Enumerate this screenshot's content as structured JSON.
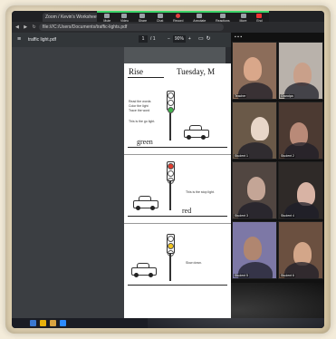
{
  "browser": {
    "tab_title": "Zoom / Kevin's Worksheet",
    "url": "file:///C:/Users/Documents/traffic-lights.pdf"
  },
  "zoom_toolbar": {
    "buttons": [
      {
        "label": "Mute",
        "icon": "mic-icon"
      },
      {
        "label": "Video",
        "icon": "camera-icon"
      },
      {
        "label": "Share",
        "icon": "share-icon"
      },
      {
        "label": "Chat",
        "icon": "chat-icon"
      },
      {
        "label": "Record",
        "icon": "record-icon"
      },
      {
        "label": "Annotate",
        "icon": "pen-icon"
      },
      {
        "label": "Reactions",
        "icon": "smile-icon"
      },
      {
        "label": "More",
        "icon": "more-icon"
      },
      {
        "label": "End",
        "icon": "end-icon"
      }
    ]
  },
  "pdf_viewer": {
    "file_name": "traffic light.pdf",
    "page_current": "1",
    "page_total": "/ 1",
    "zoom": "90%"
  },
  "worksheet": {
    "name_label": "Rise",
    "date_label": "Tuesday, M",
    "rows": [
      {
        "word": "green",
        "light_color": "#3fb34a",
        "note": "This is the go light."
      },
      {
        "word": "red",
        "light_color": "#e23b2e",
        "note": "This is the stop light."
      },
      {
        "word": "",
        "light_color": "#f3c51c",
        "note": "Slow down."
      }
    ],
    "intro_lines": [
      "Read the words",
      "Color the light",
      "Trace the word"
    ]
  },
  "participants": [
    {
      "name": "Teacher",
      "bg": "#8c6d5a",
      "skin": "#d9a78a"
    },
    {
      "name": "Grandpa",
      "bg": "#b9b2ab",
      "skin": "#c9a08a"
    },
    {
      "name": "Student 1",
      "bg": "#6a5948",
      "skin": "#e8d6c8"
    },
    {
      "name": "Student 2",
      "bg": "#4c3a32",
      "skin": "#b98a78"
    },
    {
      "name": "Student 3",
      "bg": "#514641",
      "skin": "#c4a596"
    },
    {
      "name": "Student 4",
      "bg": "#2f2a28",
      "skin": "#d8b3a4"
    },
    {
      "name": "Student 5",
      "bg": "#7d78a6",
      "skin": "#b08670"
    },
    {
      "name": "Student 6",
      "bg": "#6b5040",
      "skin": "#d3a689"
    }
  ],
  "taskbar": {
    "icons": [
      {
        "name": "windows-icon",
        "color": "#3b79d0"
      },
      {
        "name": "chrome-icon",
        "color": "#e8b10c"
      },
      {
        "name": "folder-icon",
        "color": "#d9a441"
      },
      {
        "name": "zoom-icon",
        "color": "#2d8cff"
      }
    ]
  }
}
